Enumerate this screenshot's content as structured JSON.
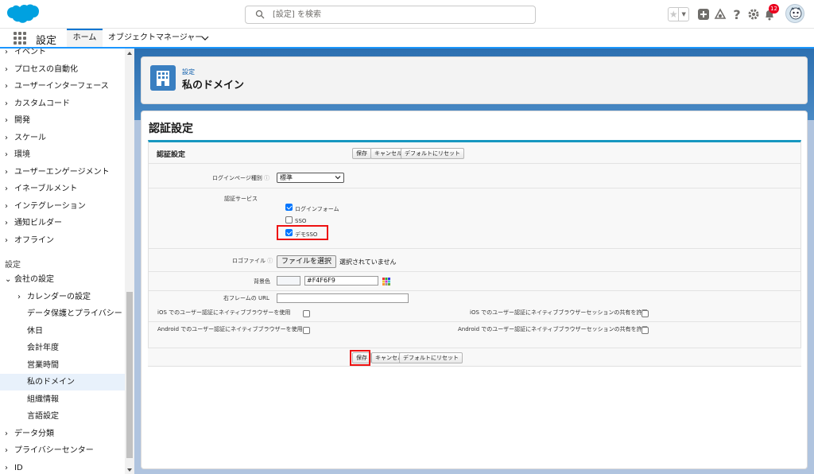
{
  "header": {
    "search_placeholder": "[設定] を検索",
    "notification_count": "12"
  },
  "context_bar": {
    "app_name": "設定",
    "tab_home": "ホーム",
    "tab_object_manager": "オブジェクトマネージャー"
  },
  "nav": {
    "items_top": [
      {
        "label": "イベント"
      },
      {
        "label": "プロセスの自動化"
      },
      {
        "label": "ユーザーインターフェース"
      },
      {
        "label": "カスタムコード"
      },
      {
        "label": "開発"
      },
      {
        "label": "スケール"
      },
      {
        "label": "環境"
      },
      {
        "label": "ユーザーエンゲージメント"
      },
      {
        "label": "イネーブルメント"
      },
      {
        "label": "インテグレーション"
      },
      {
        "label": "通知ビルダー"
      },
      {
        "label": "オフライン"
      }
    ],
    "section_settings": "設定",
    "company_settings": "会社の設定",
    "sub_items": [
      {
        "label": "カレンダーの設定"
      },
      {
        "label": "データ保護とプライバシー"
      },
      {
        "label": "休日"
      },
      {
        "label": "会計年度"
      },
      {
        "label": "営業時間"
      },
      {
        "label": "私のドメイン"
      },
      {
        "label": "組織情報"
      },
      {
        "label": "言語設定"
      }
    ],
    "items_bottom": [
      {
        "label": "データ分類"
      },
      {
        "label": "プライバシーセンター"
      },
      {
        "label": "ID"
      }
    ]
  },
  "page_header": {
    "breadcrumb": "設定",
    "title": "私のドメイン"
  },
  "content": {
    "heading": "認証設定",
    "section_title": "認証設定",
    "buttons": {
      "save": "保存",
      "cancel": "キャンセル",
      "reset": "デフォルトにリセット"
    },
    "login_page_type_label": "ログインページ種別",
    "login_page_type_value": "標準",
    "auth_service_label": "認証サービス",
    "auth_services": [
      {
        "label": "ログインフォーム",
        "checked": true
      },
      {
        "label": "SSO",
        "checked": false
      },
      {
        "label": "デモSSO",
        "checked": true
      }
    ],
    "logo_file_label": "ロゴファイル",
    "file_button": "ファイルを選択",
    "file_status": "選択されていません",
    "bg_color_label": "背景色",
    "bg_color_value": "#F4F6F9",
    "right_frame_url_label": "右フレームの URL",
    "right_frame_url_value": "",
    "ios_native_label": "iOS でのユーザー認証にネイティブブラウザーを使用",
    "ios_session_label": "iOS でのユーザー認証にネイティブブラウザーセッションの共有を許可",
    "android_native_label": "Android でのユーザー認証にネイティブブラウザーを使用",
    "android_session_label": "Android でのユーザー認証にネイティブブラウザーセッションの共有を許可"
  },
  "colors": {
    "brand_blue": "#0176d3",
    "section_blue": "#1797c0",
    "highlight_red": "#e11111"
  }
}
